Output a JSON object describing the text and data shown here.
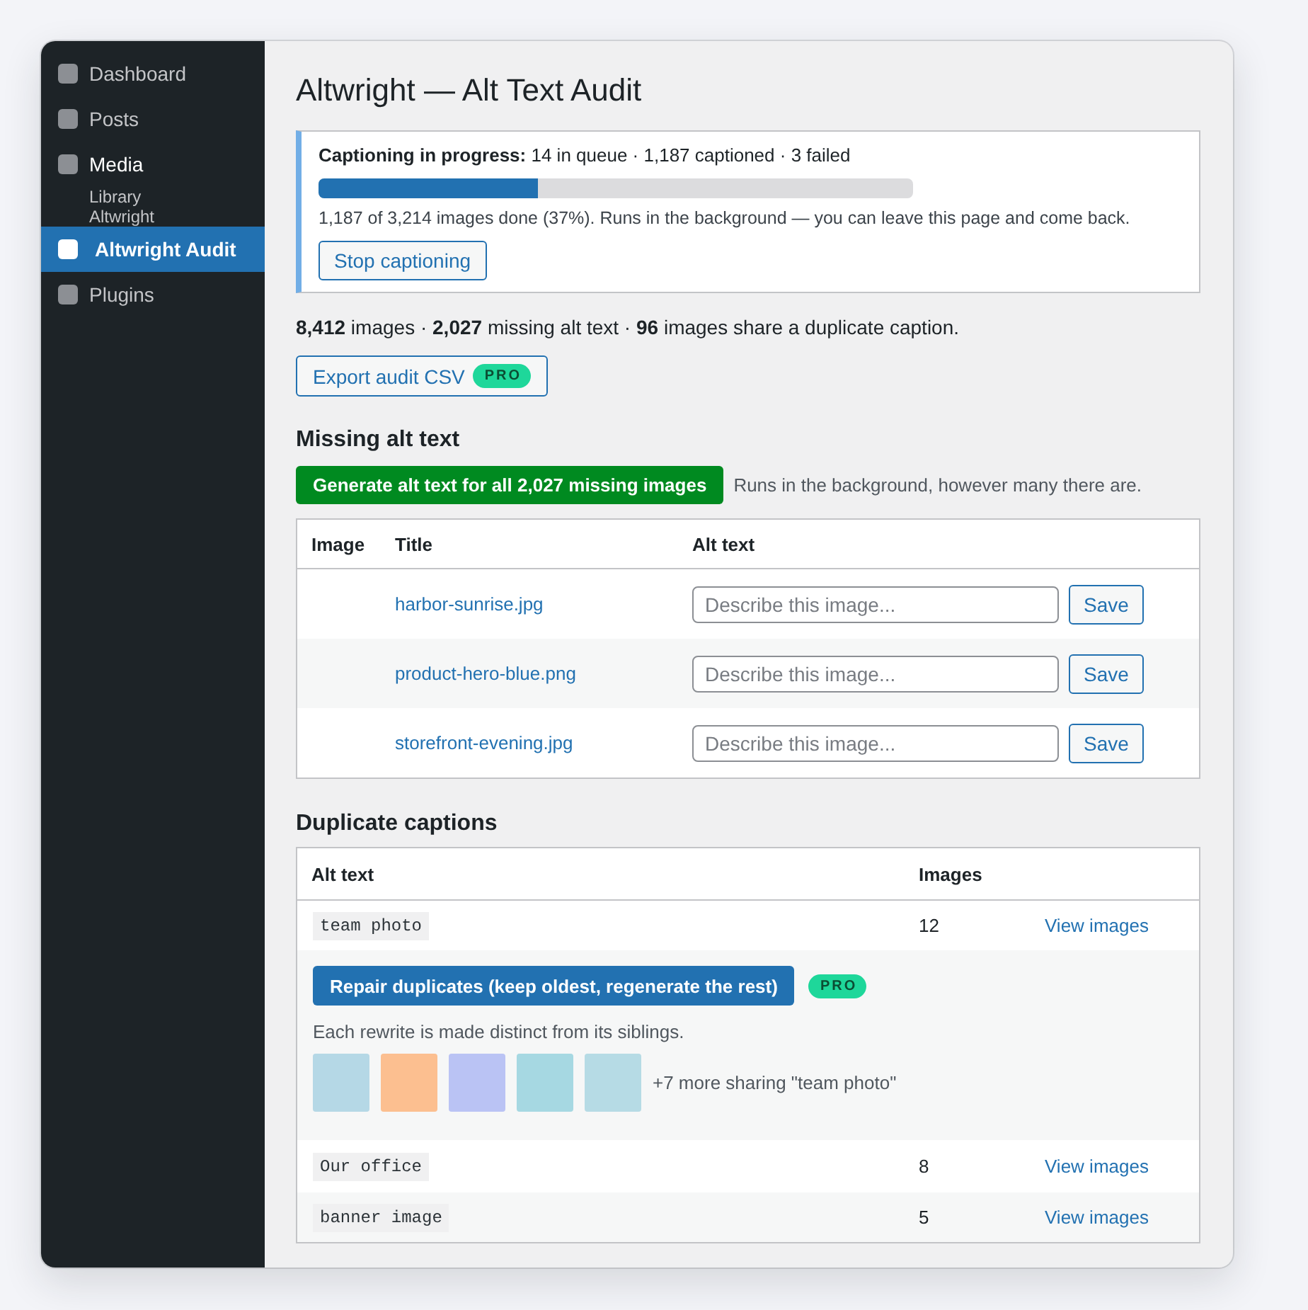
{
  "sidebar": {
    "items": [
      {
        "label": "Dashboard",
        "selected": false,
        "expanded": false
      },
      {
        "label": "Posts",
        "selected": false,
        "expanded": false
      },
      {
        "label": "Media",
        "selected": false,
        "expanded": true,
        "children": [
          {
            "label": "Library"
          },
          {
            "label": "Altwright"
          }
        ]
      },
      {
        "label": "Altwright Audit",
        "selected": true,
        "expanded": false
      },
      {
        "label": "Plugins",
        "selected": false,
        "expanded": false
      }
    ]
  },
  "page": {
    "title": "Altwright — Alt Text Audit"
  },
  "progress_notice": {
    "status": "**Captioning in progress:** 14 in queue · 1,187 captioned · 3 failed",
    "level": 0.37,
    "detail": "1,187 of 3,214 images done (37%). Runs in the background — you can leave this page and come back.",
    "button": "Stop captioning"
  },
  "summary": {
    "text": "**8,412** images · **2,027** missing alt text · **96** images share a duplicate caption.",
    "export_button": {
      "label": "Export audit CSV",
      "badge": "PRO"
    }
  },
  "missing_alt_text": {
    "heading": "Missing alt text",
    "generate_button": "Generate alt text for all 2,027 missing images",
    "hint": "Runs in the background, however many there are.",
    "table": {
      "columns": [
        "Image",
        "Title",
        "Alt text"
      ],
      "rows": [
        {
          "title": "harbor-sunrise.jpg",
          "placeholder": "Describe this image...",
          "button": "Save"
        },
        {
          "title": "product-hero-blue.png",
          "placeholder": "Describe this image...",
          "button": "Save"
        },
        {
          "title": "storefront-evening.jpg",
          "placeholder": "Describe this image...",
          "button": "Save"
        }
      ]
    }
  },
  "duplicate_captions": {
    "heading": "Duplicate captions",
    "table": {
      "columns": [
        "Alt text",
        "Images"
      ],
      "rows": [
        {
          "alt_text": "team photo",
          "images": "12",
          "link": "View images",
          "details": {
            "button": "Repair duplicates (keep oldest, regenerate the rest)",
            "badge": "PRO",
            "note": "Each rewrite is made distinct from its siblings.",
            "thumbnails": [
              {
                "color": "#b5d8e6"
              },
              {
                "color": "#fcbf90"
              },
              {
                "color": "#bac3f4"
              },
              {
                "color": "#a6d8e2"
              },
              {
                "color": "#b6dbe5"
              }
            ],
            "more": "+7 more sharing \"team photo\""
          }
        },
        {
          "alt_text": "Our office",
          "images": "8",
          "link": "View images"
        },
        {
          "alt_text": "banner image",
          "images": "5",
          "link": "View images"
        }
      ]
    }
  }
}
